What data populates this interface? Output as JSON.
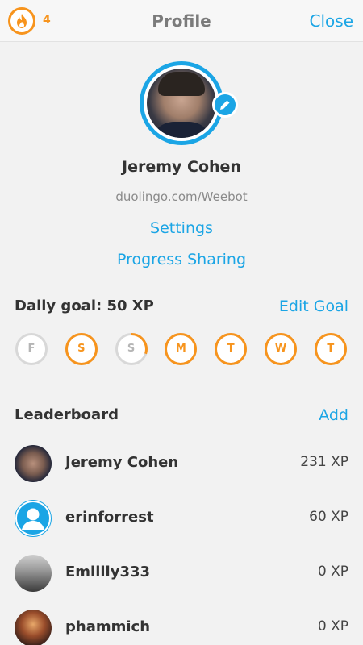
{
  "header": {
    "title": "Profile",
    "close_label": "Close",
    "streak_count": "4",
    "streak_icon": "flame-icon",
    "accent": "#1ba5e5",
    "streak_color": "#f7941d"
  },
  "profile": {
    "name": "Jeremy Cohen",
    "url": "duolingo.com/Weebot",
    "settings_label": "Settings",
    "sharing_label": "Progress Sharing"
  },
  "goal": {
    "title": "Daily goal: 50 XP",
    "edit_label": "Edit Goal",
    "days": [
      {
        "letter": "F",
        "progress": 0
      },
      {
        "letter": "S",
        "progress": 1
      },
      {
        "letter": "S",
        "progress": 0.3
      },
      {
        "letter": "M",
        "progress": 1
      },
      {
        "letter": "T",
        "progress": 1
      },
      {
        "letter": "W",
        "progress": 1
      },
      {
        "letter": "T",
        "progress": 1
      }
    ]
  },
  "leaderboard": {
    "title": "Leaderboard",
    "add_label": "Add",
    "rows": [
      {
        "name": "Jeremy Cohen",
        "xp": "231 XP"
      },
      {
        "name": "erinforrest",
        "xp": "60 XP"
      },
      {
        "name": "Emilily333",
        "xp": "0 XP"
      },
      {
        "name": "phammich",
        "xp": "0 XP"
      }
    ]
  }
}
